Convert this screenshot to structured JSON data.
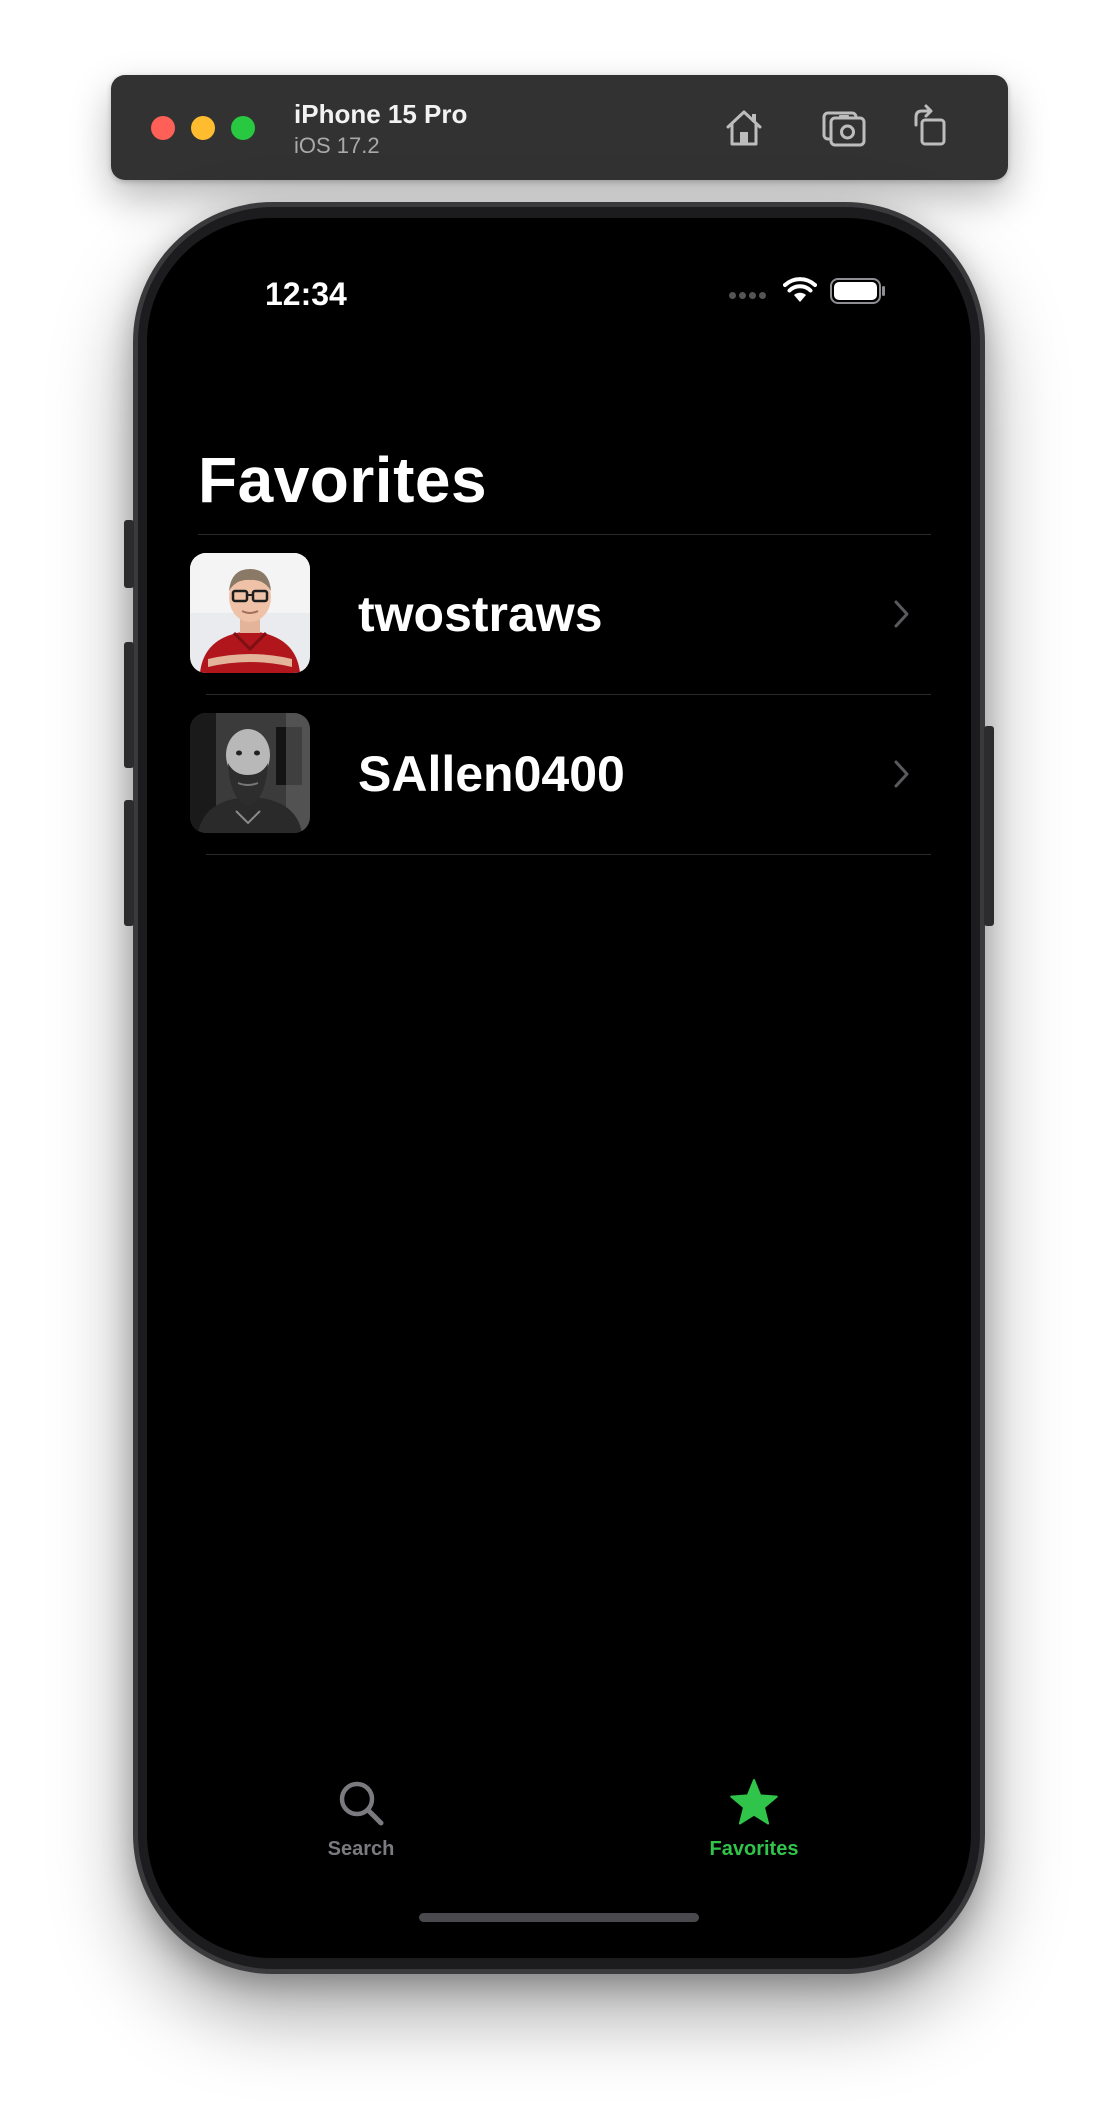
{
  "simulator": {
    "device_name": "iPhone 15 Pro",
    "os_version": "iOS 17.2",
    "buttons": [
      "home-icon",
      "screenshot-icon",
      "rotate-icon"
    ]
  },
  "status_bar": {
    "time": "12:34"
  },
  "screen": {
    "title": "Favorites",
    "favorites": [
      {
        "username": "twostraws",
        "avatar": "avatar-twostraws"
      },
      {
        "username": "SAllen0400",
        "avatar": "avatar-sallen0400"
      }
    ]
  },
  "tabbar": {
    "tabs": [
      {
        "label": "Search",
        "icon": "magnifying-glass-icon",
        "selected": false
      },
      {
        "label": "Favorites",
        "icon": "star-icon",
        "selected": true
      }
    ]
  },
  "colors": {
    "accent": "#30c44a",
    "background": "#000000",
    "toolbar": "#323232",
    "inactive_tab": "#7a7a7f"
  }
}
